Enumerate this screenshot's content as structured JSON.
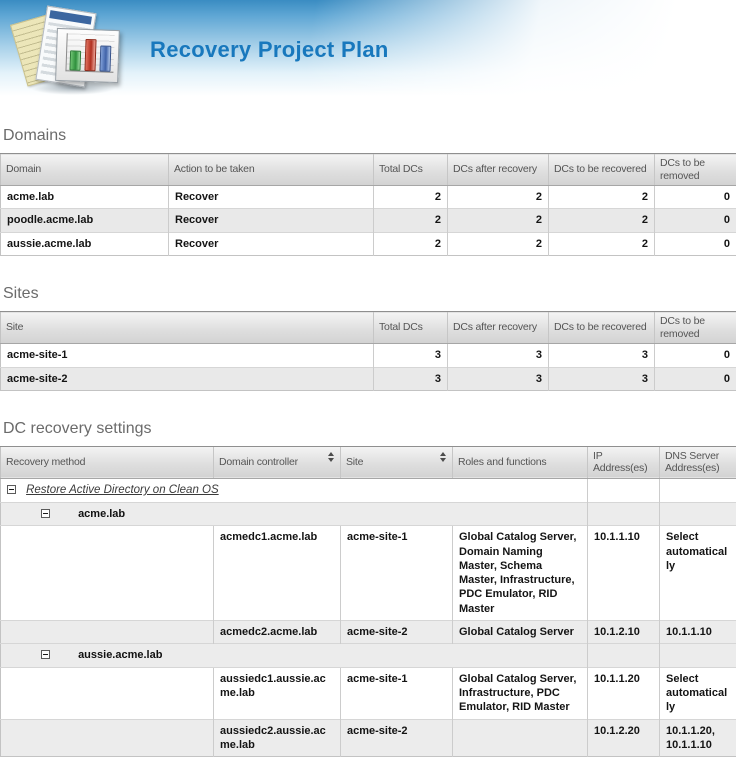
{
  "header": {
    "title": "Recovery Project Plan"
  },
  "icons": {
    "logo_icon": "documents-with-bar-chart",
    "collapse_icon": "minus-in-box",
    "sort_icon": "up-down-triangles"
  },
  "colors": {
    "title_blue": "#1878bd",
    "banner_blue_top": "#3a8cc2",
    "section_title_gray": "#6b6b6b",
    "header_cell_text": "#555555",
    "row_alt_gray": "#e9e9e9",
    "bar_green": "#2e8f3c",
    "bar_red": "#b03020",
    "bar_blue": "#3f62a8"
  },
  "domains": {
    "title": "Domains",
    "columns": [
      "Domain",
      "Action to be taken",
      "Total DCs",
      "DCs after recovery",
      "DCs to be recovered",
      "DCs to be removed"
    ],
    "rows": [
      {
        "domain": "acme.lab",
        "action": "Recover",
        "total_dcs": "2",
        "dcs_after_recovery": "2",
        "dcs_to_be_recovered": "2",
        "dcs_to_be_removed": "0"
      },
      {
        "domain": "poodle.acme.lab",
        "action": "Recover",
        "total_dcs": "2",
        "dcs_after_recovery": "2",
        "dcs_to_be_recovered": "2",
        "dcs_to_be_removed": "0"
      },
      {
        "domain": "aussie.acme.lab",
        "action": "Recover",
        "total_dcs": "2",
        "dcs_after_recovery": "2",
        "dcs_to_be_recovered": "2",
        "dcs_to_be_removed": "0"
      }
    ]
  },
  "sites": {
    "title": "Sites",
    "columns": [
      "Site",
      "Total DCs",
      "DCs after recovery",
      "DCs to be recovered",
      "DCs to be removed"
    ],
    "rows": [
      {
        "site": "acme-site-1",
        "total_dcs": "3",
        "dcs_after_recovery": "3",
        "dcs_to_be_recovered": "3",
        "dcs_to_be_removed": "0"
      },
      {
        "site": "acme-site-2",
        "total_dcs": "3",
        "dcs_after_recovery": "3",
        "dcs_to_be_recovered": "3",
        "dcs_to_be_removed": "0"
      }
    ]
  },
  "dc_settings": {
    "title": "DC recovery settings",
    "columns": [
      "Recovery method",
      "Domain controller",
      "Site",
      "Roles and functions",
      "IP Address(es)",
      "DNS Server Address(es)"
    ],
    "recovery_method_group": "Restore Active Directory on Clean OS",
    "domain_groups": [
      {
        "domain": "acme.lab",
        "dcs": [
          {
            "dc": "acmedc1.acme.lab",
            "site": "acme-site-1",
            "roles": "Global Catalog Server, Domain Naming Master, Schema Master, Infrastructure, PDC Emulator, RID Master",
            "ip": "10.1.1.10",
            "dns": "Select automatically"
          },
          {
            "dc": "acmedc2.acme.lab",
            "site": "acme-site-2",
            "roles": "Global Catalog Server",
            "ip": "10.1.2.10",
            "dns": "10.1.1.10"
          }
        ]
      },
      {
        "domain": "aussie.acme.lab",
        "dcs": [
          {
            "dc": "aussiedc1.aussie.acme.lab",
            "site": "acme-site-1",
            "roles": "Global Catalog Server, Infrastructure, PDC Emulator, RID Master",
            "ip": "10.1.1.20",
            "dns": "Select automatically"
          },
          {
            "dc": "aussiedc2.aussie.acme.lab",
            "site": "acme-site-2",
            "roles": "",
            "ip": "10.1.2.20",
            "dns": "10.1.1.20, 10.1.1.10"
          }
        ]
      }
    ]
  }
}
